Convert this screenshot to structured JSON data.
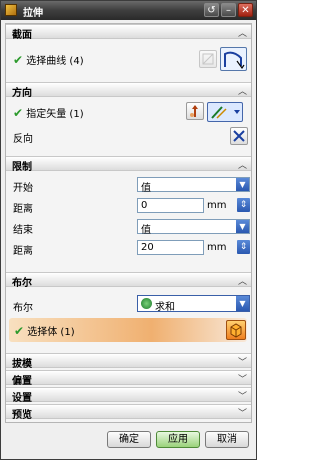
{
  "window": {
    "title": "拉伸",
    "buttons": [
      "↺",
      "–",
      "✕"
    ]
  },
  "sections": {
    "section": {
      "label": "截面",
      "select_curve": "选择曲线 (4)"
    },
    "direction": {
      "label": "方向",
      "specify_vector": "指定矢量 (1)",
      "reverse": "反向"
    },
    "limits": {
      "label": "限制",
      "start_label": "开始",
      "start_value": "值",
      "start_distance_label": "距离",
      "start_distance": "0",
      "start_unit": "mm",
      "end_label": "结束",
      "end_value": "值",
      "end_distance_label": "距离",
      "end_distance": "20",
      "end_unit": "mm"
    },
    "boolean": {
      "label": "布尔",
      "boolean_label": "布尔",
      "boolean_value": "求和",
      "select_body": "选择体 (1)"
    },
    "draft": {
      "label": "拔模"
    },
    "offset": {
      "label": "偏置"
    },
    "settings": {
      "label": "设置"
    },
    "preview": {
      "label": "预览"
    }
  },
  "footer": {
    "ok": "确定",
    "apply": "应用",
    "cancel": "取消"
  },
  "colors": {
    "accent_orange": "#f0a050",
    "check_green": "#2c9a2c",
    "dropdown_blue": "#2a58b0"
  }
}
